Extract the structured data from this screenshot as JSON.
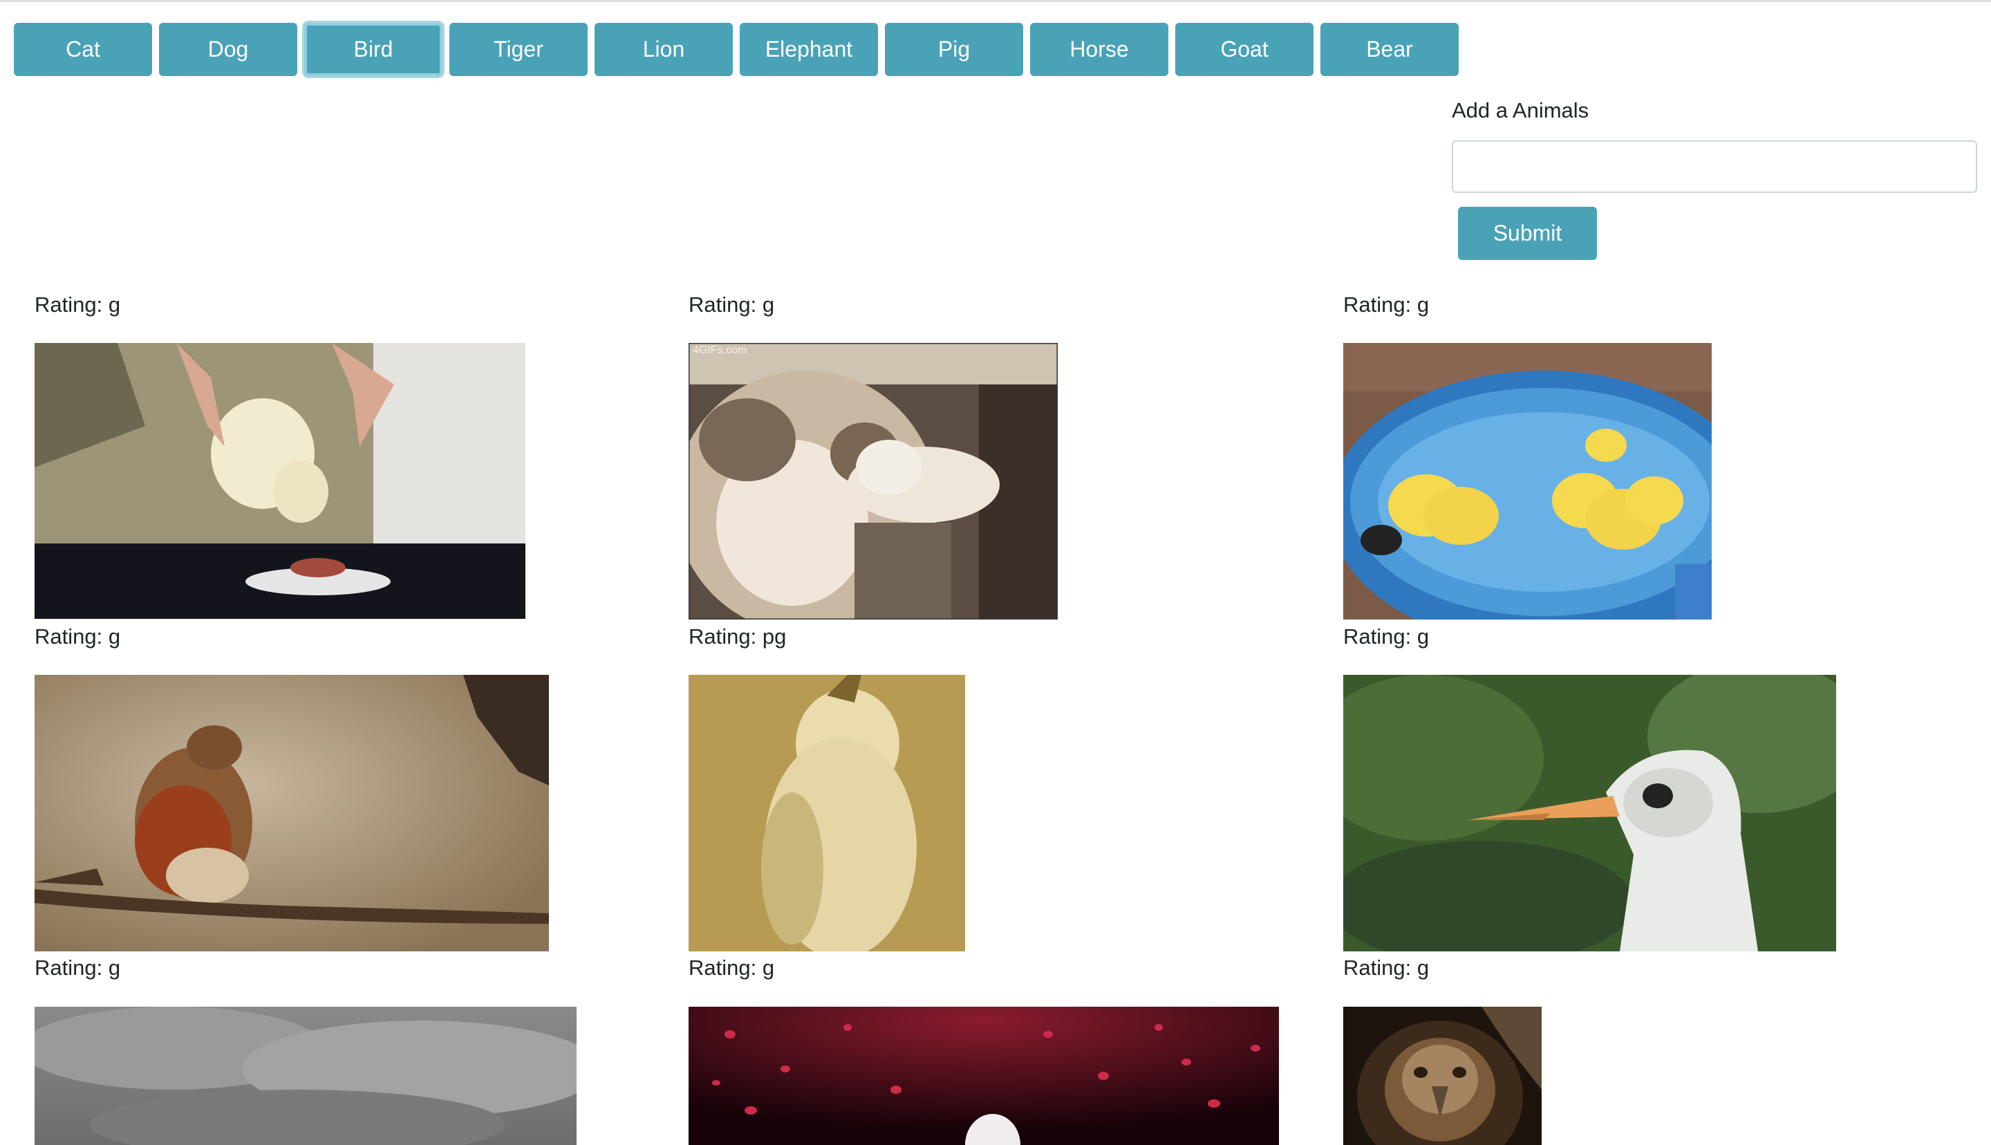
{
  "animal_buttons": [
    "Cat",
    "Dog",
    "Bird",
    "Tiger",
    "Lion",
    "Elephant",
    "Pig",
    "Horse",
    "Goat",
    "Bear"
  ],
  "form": {
    "label": "Add a Animals",
    "input_value": "",
    "submit_label": "Submit"
  },
  "gifs": [
    {
      "rating": "Rating: g",
      "subject": "chick eating from dish"
    },
    {
      "rating": "Rating: g",
      "subject": "cat and parakeet"
    },
    {
      "rating": "Rating: g",
      "subject": "ducklings in blue tub"
    },
    {
      "rating": "Rating: g",
      "subject": "robin on branch"
    },
    {
      "rating": "Rating: pg",
      "subject": "white parrot"
    },
    {
      "rating": "Rating: g",
      "subject": "white bird with orange beak"
    },
    {
      "rating": "Rating: g",
      "subject": "grey cloudy sky"
    },
    {
      "rating": "Rating: g",
      "subject": "white bird in red petals"
    },
    {
      "rating": "Rating: g",
      "subject": "eagle close-up"
    }
  ],
  "watermark": "4GIFs.com",
  "colors": {
    "accent": "#4aa2b7",
    "text": "#212529"
  }
}
